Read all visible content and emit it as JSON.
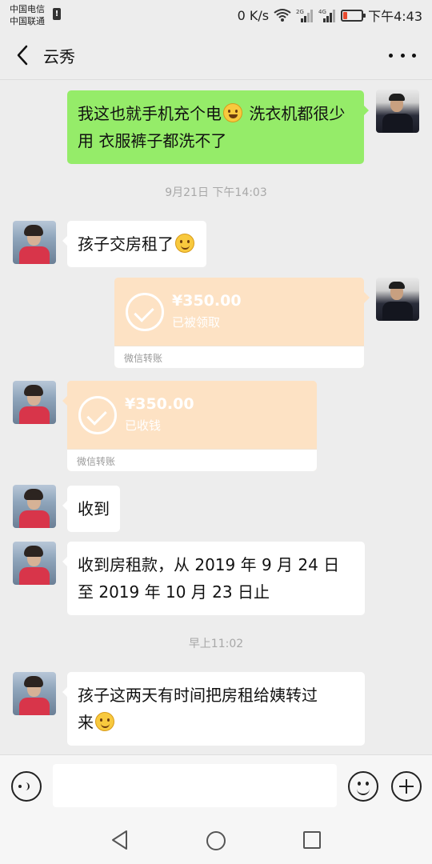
{
  "status_bar": {
    "carrier_1": "中国电信",
    "carrier_2": "中国联通",
    "network_speed": "0 K/s",
    "signal_1_label": "2G",
    "signal_2_label": "4G",
    "time": "下午4:43",
    "battery_level": 0.2,
    "battery_color": "#e84a2e"
  },
  "header": {
    "title": "云秀",
    "back_icon": "chevron-left-icon",
    "more_icon": "more-dots-icon"
  },
  "messages": [
    {
      "sender": "self",
      "type": "text",
      "text_part1": "我这也就手机充个电",
      "emoji": "laugh-tears",
      "text_part2": " 洗衣机都很少用  衣服裤子都洗不了"
    },
    {
      "type": "timestamp",
      "text": "9月21日 下午14:03"
    },
    {
      "sender": "other",
      "type": "text",
      "text": "孩子交房租了",
      "emoji": "smile"
    },
    {
      "sender": "self",
      "type": "transfer",
      "amount": "¥350.00",
      "status": "已被领取",
      "footer": "微信转账"
    },
    {
      "sender": "other",
      "type": "transfer",
      "amount": "¥350.00",
      "status": "已收钱",
      "footer": "微信转账"
    },
    {
      "sender": "other",
      "type": "text",
      "text": "收到"
    },
    {
      "sender": "other",
      "type": "text",
      "line1": "收到房租款，从 2019 年 9 月 24 日",
      "line2": "至 2019 年 10 月 23 日止"
    },
    {
      "type": "timestamp",
      "text": "早上11:02"
    },
    {
      "sender": "other",
      "type": "text",
      "line1": "孩子这两天有时间把房租给姨转过",
      "line2": "来",
      "emoji": "smile"
    }
  ],
  "input_bar": {
    "placeholder": "",
    "value": "",
    "voice_icon": "voice-icon",
    "emoji_icon": "emoji-icon",
    "plus_icon": "plus-icon"
  },
  "colors": {
    "self_bubble": "#95ec69",
    "other_bubble": "#ffffff",
    "transfer_card": "#fde2c4",
    "background": "#ededed"
  }
}
